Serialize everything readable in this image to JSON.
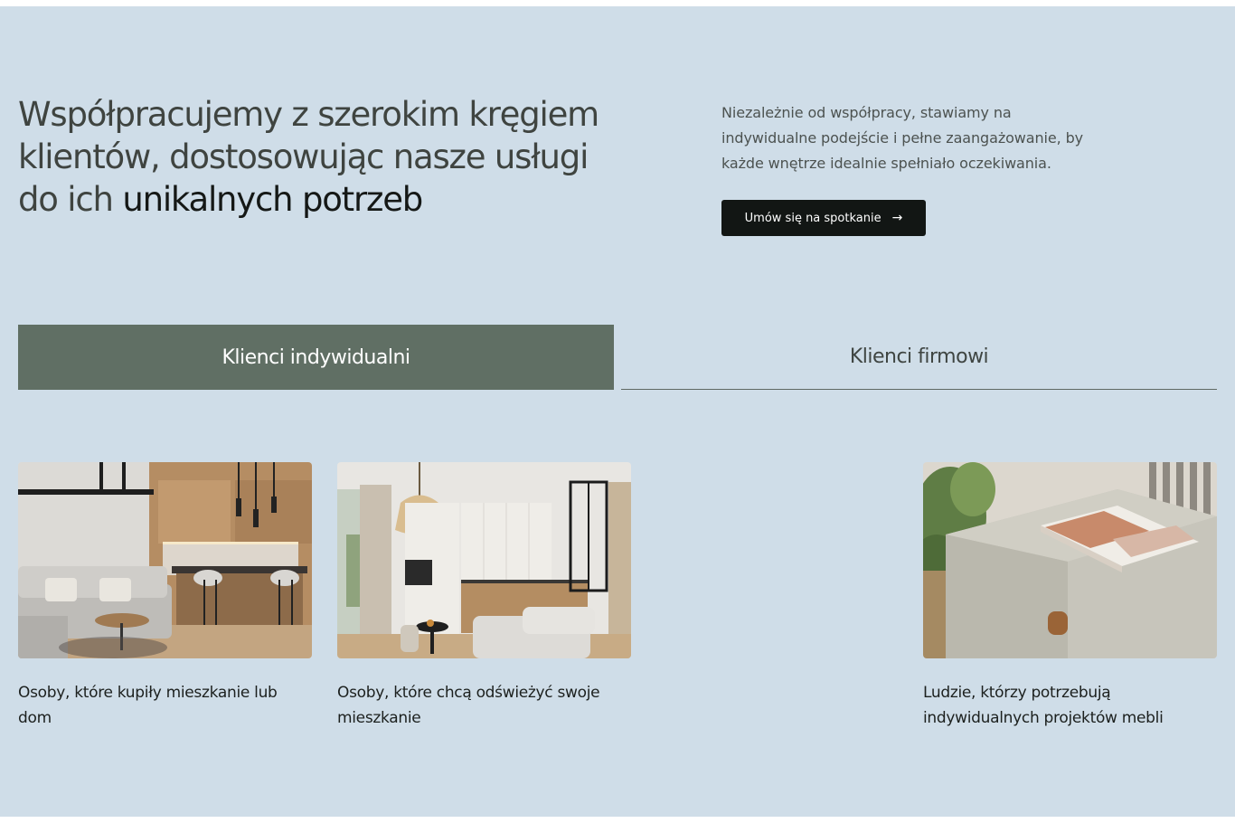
{
  "hero": {
    "headline_part1": "Współpracujemy z szerokim kręgiem klientów, dostosowując nasze usługi do ich ",
    "headline_part2": "unikalnych potrzeb",
    "intro": "Niezależnie od współpracy, stawiamy na indywidualne podejście i pełne zaangażowanie, by każde wnętrze idealnie spełniało oczekiwania.",
    "cta_label": "Umów się na spotkanie",
    "cta_icon": "arrow-right-icon"
  },
  "tabs": [
    {
      "label": "Klienci indywidualni",
      "active": true
    },
    {
      "label": "Klienci firmowi",
      "active": false
    }
  ],
  "cards": [
    {
      "caption": "Osoby, które kupiły mieszkanie lub dom",
      "image": "living-room-kitchen-photo"
    },
    {
      "caption": "Osoby, które chcą odświeżyć swoje mieszkanie",
      "image": "kitchen-living-room-photo"
    },
    {
      "caption": "Ludzie, którzy potrzebują indywidualnych projektów mebli",
      "image": "cabinet-detail-photo"
    }
  ],
  "colors": {
    "background": "#cfdde8",
    "active_tab": "#606f64",
    "button": "#121614"
  }
}
